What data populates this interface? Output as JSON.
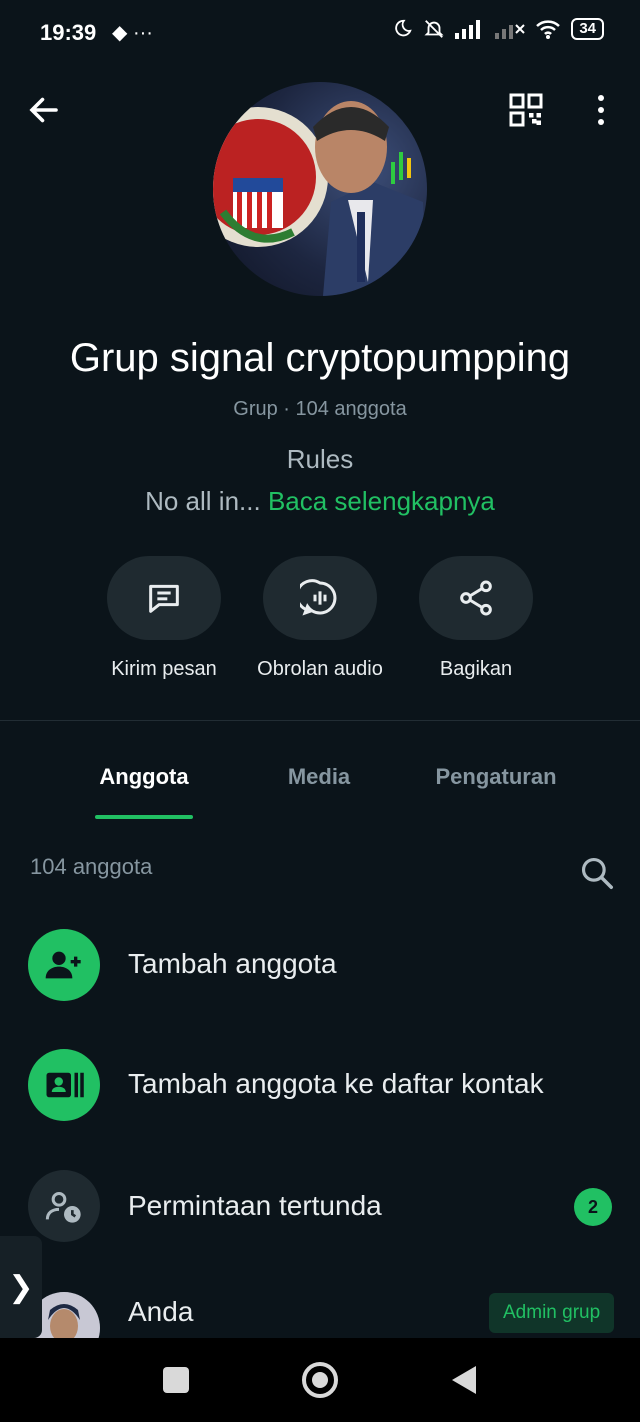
{
  "status_bar": {
    "time": "19:39",
    "extra": "◆  ···",
    "battery": "34"
  },
  "header": {
    "back_icon": "arrow-left-icon",
    "qr_icon": "qr-code-icon",
    "menu_icon": "more-vertical-icon"
  },
  "group": {
    "name": "Grup signal cryptopumpping",
    "meta": "Grup · 104 anggota",
    "description_title": "Rules",
    "description_text": "No all in...",
    "read_more": "Baca selengkapnya"
  },
  "actions": [
    {
      "label": "Kirim pesan",
      "icon": "message-icon"
    },
    {
      "label": "Obrolan audio",
      "icon": "audio-chat-icon"
    },
    {
      "label": "Bagikan",
      "icon": "share-icon"
    }
  ],
  "tabs": [
    {
      "label": "Anggota",
      "active": true
    },
    {
      "label": "Media",
      "active": false
    },
    {
      "label": "Pengaturan",
      "active": false
    }
  ],
  "members": {
    "count_label": "104 anggota",
    "rows": [
      {
        "label": "Tambah anggota",
        "icon": "add-person-icon"
      },
      {
        "label": "Tambah anggota ke daftar kontak",
        "icon": "contact-card-icon"
      },
      {
        "label": "Permintaan tertunda",
        "icon": "pending-person-icon",
        "badge": "2"
      },
      {
        "label": "Anda",
        "badge": "Admin grup"
      }
    ]
  },
  "colors": {
    "accent": "#21c063",
    "background": "#0b141a",
    "surface": "#1f2a30"
  }
}
